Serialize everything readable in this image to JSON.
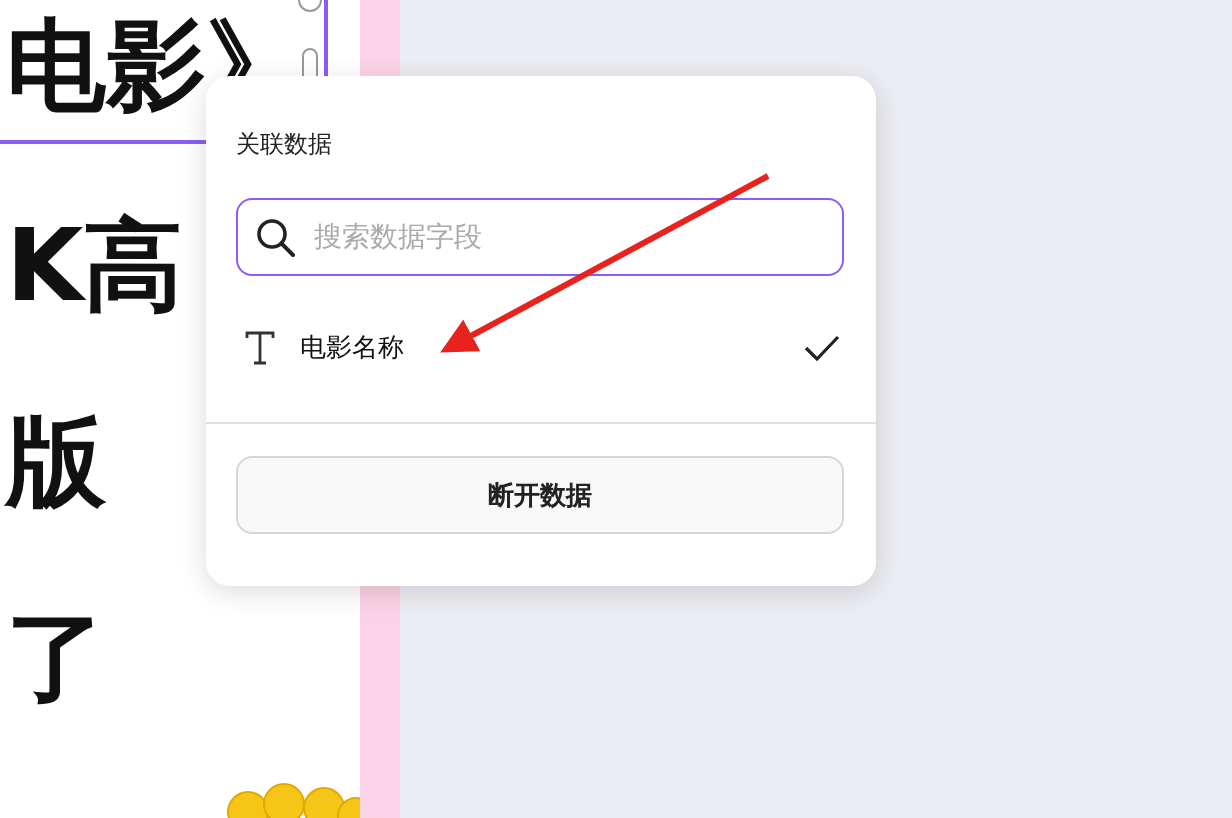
{
  "canvas": {
    "lines": [
      {
        "text": "电影》",
        "selected": true
      },
      {
        "text": "K高",
        "selected": false
      },
      {
        "text": "版",
        "selected": false
      },
      {
        "text": "了",
        "selected": false
      }
    ]
  },
  "popup": {
    "title": "关联数据",
    "search": {
      "placeholder": "搜索数据字段"
    },
    "fields": [
      {
        "label": "电影名称",
        "selected": true
      }
    ],
    "button": "断开数据"
  }
}
